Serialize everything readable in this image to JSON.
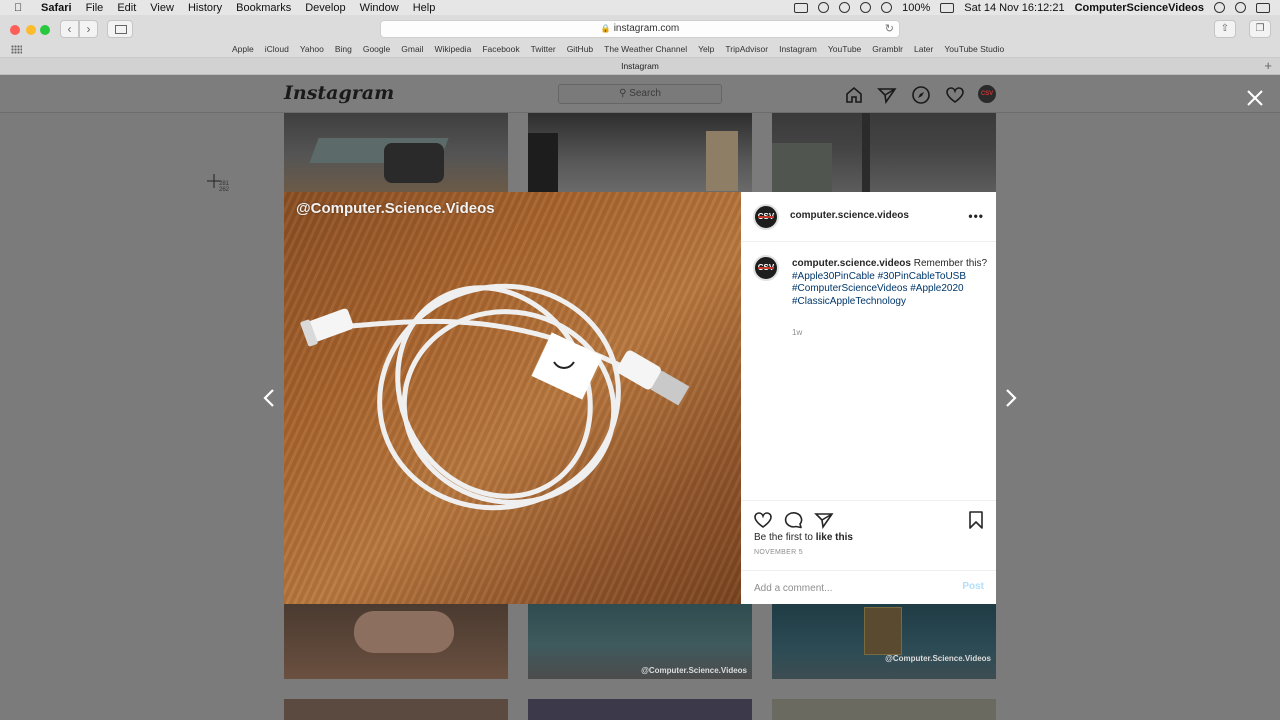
{
  "menubar": {
    "app": "Safari",
    "items": [
      "File",
      "Edit",
      "View",
      "History",
      "Bookmarks",
      "Develop",
      "Window",
      "Help"
    ],
    "battery": "100%",
    "datetime": "Sat 14 Nov  16:12:21",
    "user": "ComputerScienceVideos"
  },
  "browser": {
    "url": "instagram.com",
    "tab_title": "Instagram",
    "favorites": [
      "Apple",
      "iCloud",
      "Yahoo",
      "Bing",
      "Google",
      "Gmail",
      "Wikipedia",
      "Facebook",
      "Twitter",
      "GitHub",
      "The Weather Channel",
      "Yelp",
      "TripAdvisor",
      "Instagram",
      "YouTube",
      "Gramblr",
      "Later",
      "YouTube Studio"
    ]
  },
  "instagram": {
    "logo": "Instagram",
    "search_placeholder": "Search",
    "profile_initials": "CSV",
    "thumb_watermark_1": "@Computer.Science.Videos",
    "thumb_watermark_2": "@Computer.Science.Videos"
  },
  "post": {
    "photo_watermark": "@Computer.Science.Videos",
    "username": "computer.science.videos",
    "avatar_text": "CSV",
    "more": "•••",
    "caption_text": "Remember this?",
    "hashtags": [
      "#Apple30PinCable",
      "#30PinCableToUSB",
      "#ComputerScienceVideos",
      "#Apple2020",
      "#ClassicAppleTechnology"
    ],
    "time_ago": "1w",
    "likes_prefix": "Be the first to ",
    "likes_action": "like this",
    "date": "NOVEMBER 5",
    "comment_placeholder": "Add a comment...",
    "post_label": "Post"
  },
  "cursor": {
    "readout_x": "281",
    "readout_y": "262"
  },
  "colors": {
    "link": "#00376b",
    "post_disabled": "#b2dffc",
    "overlay": "#7b7b7b"
  }
}
